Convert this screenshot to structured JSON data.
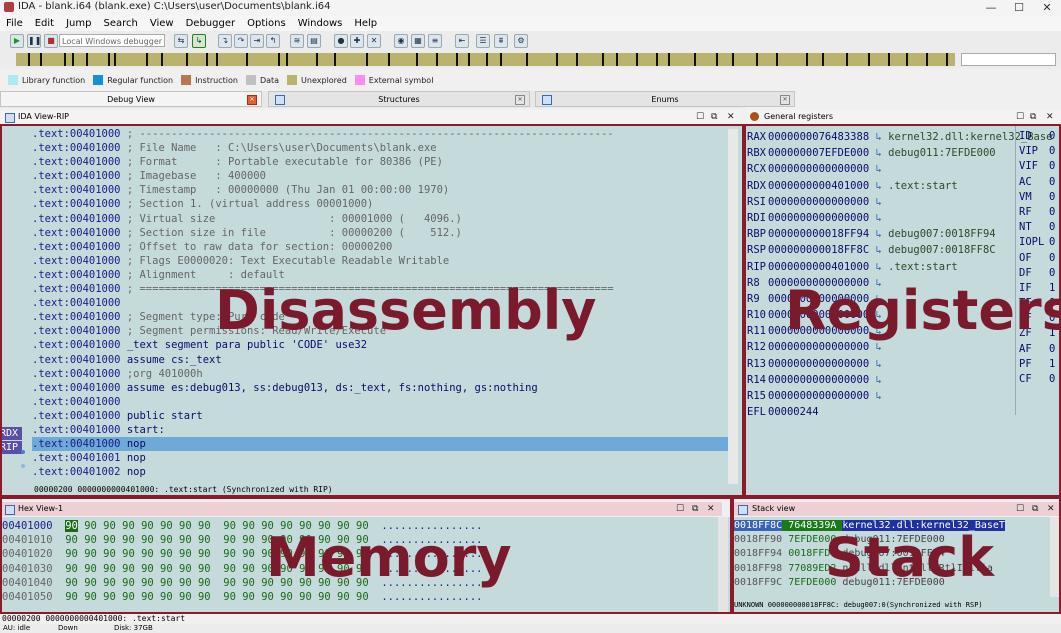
{
  "window": {
    "title": "IDA - blank.i64 (blank.exe) C:\\Users\\user\\Documents\\blank.i64",
    "min": "—",
    "max": "☐",
    "close": "✕"
  },
  "menu": [
    "File",
    "Edit",
    "Jump",
    "Search",
    "View",
    "Debugger",
    "Options",
    "Windows",
    "Help"
  ],
  "toolbar": {
    "debugger_select": "Local Windows debugger"
  },
  "legend": [
    {
      "label": "Library function",
      "color": "#aee8f0"
    },
    {
      "label": "Regular function",
      "color": "#1a8fd8"
    },
    {
      "label": "Instruction",
      "color": "#b87654"
    },
    {
      "label": "Data",
      "color": "#c0c0c0"
    },
    {
      "label": "Unexplored",
      "color": "#b9b36e"
    },
    {
      "label": "External symbol",
      "color": "#ff8cf0"
    }
  ],
  "tabs": [
    {
      "label": "Debug View"
    },
    {
      "label": "Structures"
    },
    {
      "label": "Enums"
    }
  ],
  "disasm": {
    "title": "IDA View-RIP",
    "lines": [
      ".text:00401000 ; ---------------------------------------------------------------------------",
      ".text:00401000 ; File Name   : C:\\Users\\user\\Documents\\blank.exe",
      ".text:00401000 ; Format      : Portable executable for 80386 (PE)",
      ".text:00401000 ; Imagebase   : 400000",
      ".text:00401000 ; Timestamp   : 00000000 (Thu Jan 01 00:00:00 1970)",
      ".text:00401000 ; Section 1. (virtual address 00001000)",
      ".text:00401000 ; Virtual size                  : 00001000 (   4096.)",
      ".text:00401000 ; Section size in file          : 00000200 (    512.)",
      ".text:00401000 ; Offset to raw data for section: 00000200",
      ".text:00401000 ; Flags E0000020: Text Executable Readable Writable",
      ".text:00401000 ; Alignment     : default",
      ".text:00401000 ; ===========================================================================",
      ".text:00401000",
      ".text:00401000 ; Segment type: Pure code",
      ".text:00401000 ; Segment permissions: Read/Write/Execute",
      ".text:00401000 _text segment para public 'CODE' use32",
      ".text:00401000 assume cs:_text",
      ".text:00401000 ;org 401000h",
      ".text:00401000 assume es:debug013, ss:debug013, ds:_text, fs:nothing, gs:nothing",
      ".text:00401000",
      ".text:00401000 public start",
      ".text:00401000 start:",
      ".text:00401000 nop",
      ".text:00401001 nop",
      ".text:00401002 nop"
    ],
    "highlight_index": 22,
    "gutter_labels": [
      "RDX",
      "RIP"
    ],
    "status": "00000200 0000000000401000: .text:start (Synchronized with RIP)"
  },
  "registers": {
    "title": "General registers",
    "rows": [
      {
        "name": "RAX",
        "value": "0000000076483388",
        "ref": "kernel32.dll:kernel32_Base"
      },
      {
        "name": "RBX",
        "value": "000000007EFDE000",
        "ref": "debug011:7EFDE000"
      },
      {
        "name": "RCX",
        "value": "0000000000000000",
        "ref": ""
      },
      {
        "name": "RDX",
        "value": "0000000000401000",
        "ref": ".text:start"
      },
      {
        "name": "RSI",
        "value": "0000000000000000",
        "ref": ""
      },
      {
        "name": "RDI",
        "value": "0000000000000000",
        "ref": ""
      },
      {
        "name": "RBP",
        "value": "000000000018FF94",
        "ref": "debug007:0018FF94"
      },
      {
        "name": "RSP",
        "value": "000000000018FF8C",
        "ref": "debug007:0018FF8C"
      },
      {
        "name": "RIP",
        "value": "0000000000401000",
        "ref": ".text:start"
      },
      {
        "name": "R8",
        "value": "0000000000000000",
        "ref": ""
      },
      {
        "name": "R9",
        "value": "0000000000000000",
        "ref": ""
      },
      {
        "name": "R10",
        "value": "0000000000000000",
        "ref": ""
      },
      {
        "name": "R11",
        "value": "0000000000000000",
        "ref": ""
      },
      {
        "name": "R12",
        "value": "0000000000000000",
        "ref": ""
      },
      {
        "name": "R13",
        "value": "0000000000000000",
        "ref": ""
      },
      {
        "name": "R14",
        "value": "0000000000000000",
        "ref": ""
      },
      {
        "name": "R15",
        "value": "0000000000000000",
        "ref": ""
      },
      {
        "name": "EFL",
        "value": "00000244",
        "ref": ""
      }
    ],
    "flags": [
      {
        "name": "ID",
        "value": "0"
      },
      {
        "name": "VIP",
        "value": "0"
      },
      {
        "name": "VIF",
        "value": "0"
      },
      {
        "name": "AC",
        "value": "0"
      },
      {
        "name": "VM",
        "value": "0"
      },
      {
        "name": "RF",
        "value": "0"
      },
      {
        "name": "NT",
        "value": "0"
      },
      {
        "name": "IOPL",
        "value": "0"
      },
      {
        "name": "OF",
        "value": "0"
      },
      {
        "name": "DF",
        "value": "0"
      },
      {
        "name": "IF",
        "value": "1"
      },
      {
        "name": "TF",
        "value": "0"
      },
      {
        "name": "SF",
        "value": "0"
      },
      {
        "name": "ZF",
        "value": "1"
      },
      {
        "name": "AF",
        "value": "0"
      },
      {
        "name": "PF",
        "value": "1"
      },
      {
        "name": "CF",
        "value": "0"
      }
    ]
  },
  "hex": {
    "title": "Hex View-1",
    "rows": [
      {
        "addr": "00401000",
        "bytes": "90 90 90 90 90 90 90 90  90 90 90 90 90 90 90 90",
        "ascii": "................"
      },
      {
        "addr": "00401010",
        "bytes": "90 90 90 90 90 90 90 90  90 90 90 90 90 90 90 90",
        "ascii": "................"
      },
      {
        "addr": "00401020",
        "bytes": "90 90 90 90 90 90 90 90  90 90 90 90 90 90 90 90",
        "ascii": "................"
      },
      {
        "addr": "00401030",
        "bytes": "90 90 90 90 90 90 90 90  90 90 90 90 90 90 90 90",
        "ascii": "................"
      },
      {
        "addr": "00401040",
        "bytes": "90 90 90 90 90 90 90 90  90 90 90 90 90 90 90 90",
        "ascii": "................"
      },
      {
        "addr": "00401050",
        "bytes": "90 90 90 90 90 90 90 90  90 90 90 90 90 90 90 90",
        "ascii": "................"
      }
    ],
    "status": "00000200 0000000000401000: .text:start"
  },
  "stack": {
    "title": "Stack view",
    "rows": [
      {
        "addr": "0018FF8C",
        "value": "7648339A",
        "ref": "kernel32.dll:kernel32_BaseT"
      },
      {
        "addr": "0018FF90",
        "value": "7EFDE000",
        "ref": "debug011:7EFDE000"
      },
      {
        "addr": "0018FF94",
        "value": "0018FFD4",
        "ref": "debug007:0018FFD4"
      },
      {
        "addr": "0018FF98",
        "value": "77089ED2",
        "ref": "ntdll.dll:ntdll_RtlInitia"
      },
      {
        "addr": "0018FF9C",
        "value": "7EFDE000",
        "ref": "debug011:7EFDE000"
      }
    ],
    "status": "UNKNOWN 000000000018FF8C: debug007:0(Synchronized with RSP)"
  },
  "overlays": {
    "disasm": "Disassembly",
    "registers": "Registers",
    "memory": "Memory",
    "stack": "Stack"
  },
  "bottom_status": {
    "auto": "AU: idle",
    "down": "Down",
    "disk": "Disk: 37GB"
  },
  "colors": {
    "pane_bg": "#c5dadb",
    "highlight": "#6fa9d8",
    "box": "#8b1a2a",
    "overlay_text": "#7a1a2c"
  }
}
